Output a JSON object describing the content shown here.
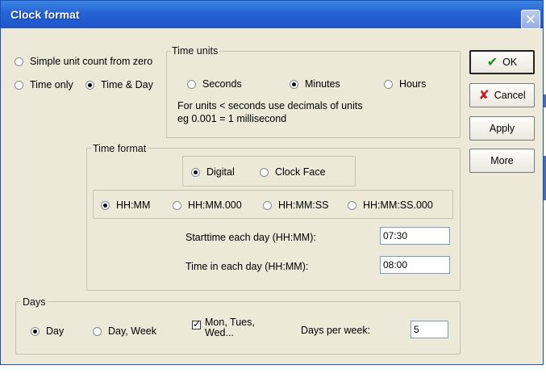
{
  "window": {
    "title": "Clock format",
    "close_glyph": "✕"
  },
  "mode": {
    "simple_count": {
      "label": "Simple unit count from zero",
      "selected": false
    },
    "time_only": {
      "label": "Time only",
      "selected": false
    },
    "time_day": {
      "label": "Time & Day",
      "selected": true
    }
  },
  "time_units": {
    "title": "Time units",
    "options": [
      {
        "label": "Seconds",
        "selected": false
      },
      {
        "label": "Minutes",
        "selected": true
      },
      {
        "label": "Hours",
        "selected": false
      }
    ],
    "note_line1": "For units < seconds use decimals of units",
    "note_line2": "eg 0.001 = 1 millisecond"
  },
  "time_format": {
    "title": "Time format",
    "display": [
      {
        "label": "Digital",
        "selected": true
      },
      {
        "label": "Clock Face",
        "selected": false
      }
    ],
    "formats": [
      {
        "label": "HH:MM",
        "selected": true
      },
      {
        "label": "HH:MM.000",
        "selected": false
      },
      {
        "label": "HH:MM:SS",
        "selected": false
      },
      {
        "label": "HH:MM:SS.000",
        "selected": false
      }
    ],
    "start_label": "Starttime each day (HH:MM):",
    "start_value": "07:30",
    "length_label": "Time in each day (HH:MM):",
    "length_value": "08:00"
  },
  "days": {
    "title": "Days",
    "options": [
      {
        "label": "Day",
        "selected": true
      },
      {
        "label": "Day, Week",
        "selected": false
      }
    ],
    "names_label": "Mon, Tues, Wed...",
    "names_checked": true,
    "check_glyph": "✓",
    "per_week_label": "Days per week:",
    "per_week_value": "5"
  },
  "buttons": {
    "ok": "OK",
    "cancel": "Cancel",
    "apply": "Apply",
    "more": "More",
    "ok_glyph": "✔",
    "cancel_glyph": "✘"
  },
  "icons": {
    "ok": "check-icon",
    "cancel": "x-icon",
    "close": "close-icon"
  }
}
